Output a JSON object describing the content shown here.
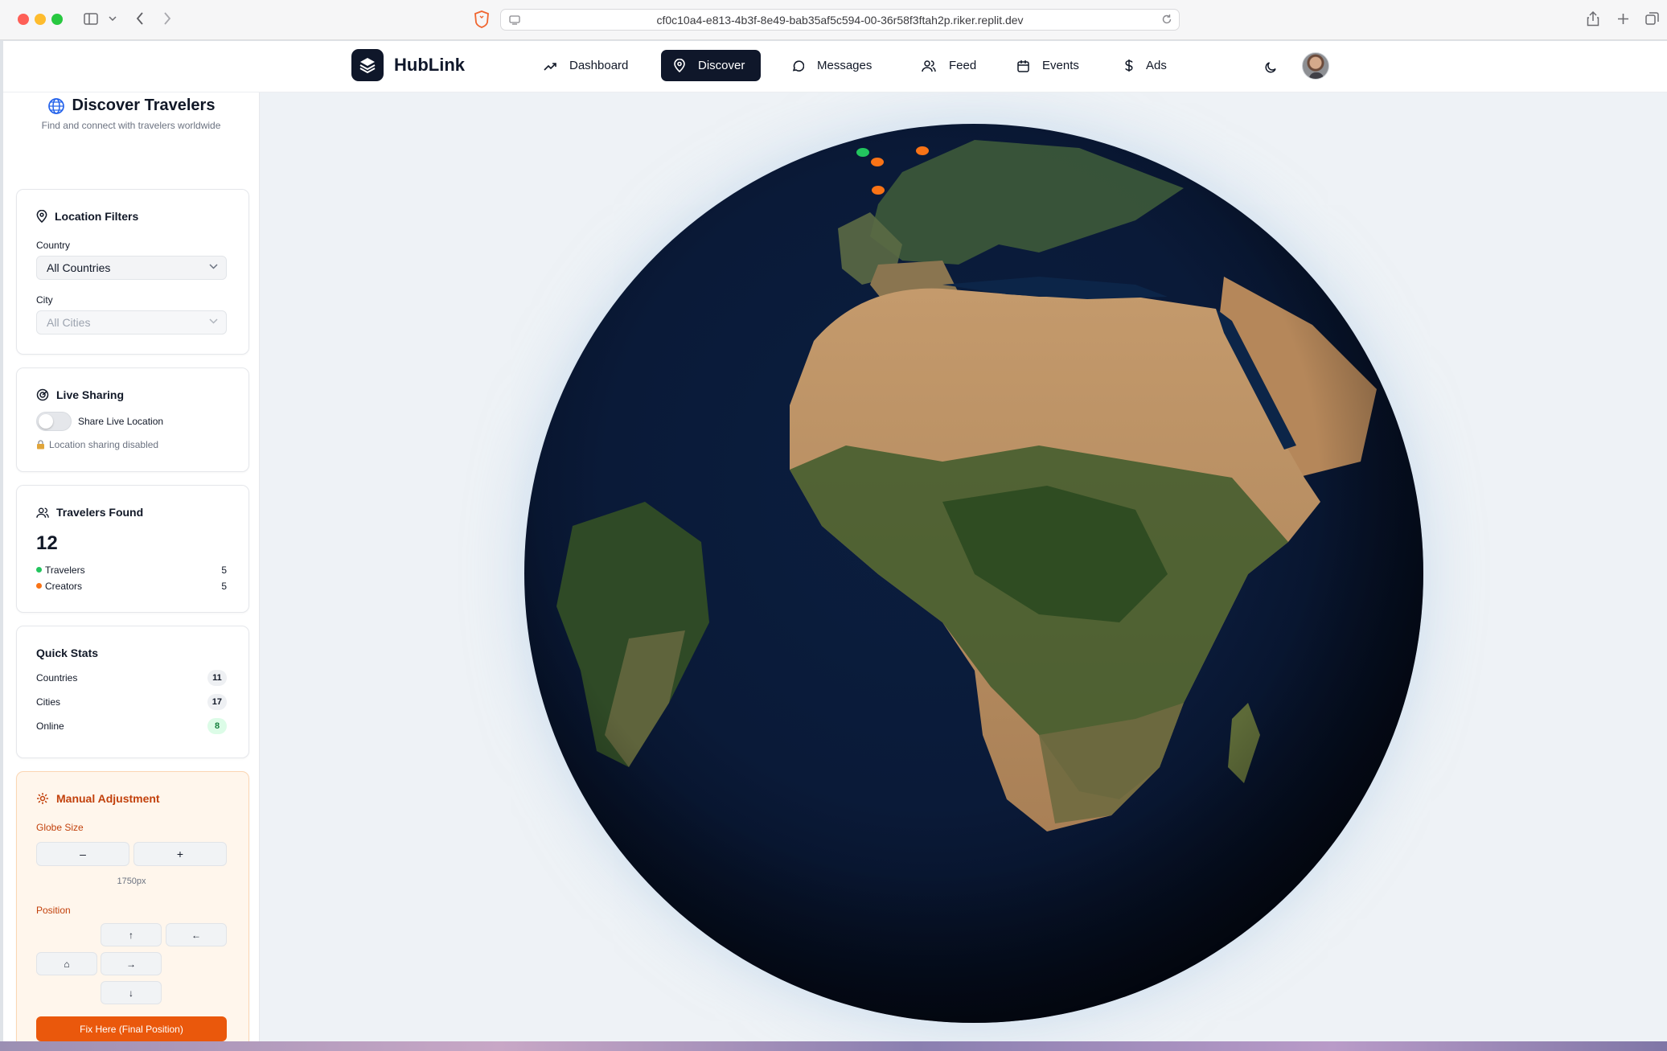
{
  "browser": {
    "url": "cf0c10a4-e813-4b3f-8e49-bab35af5c594-00-36r58f3ftah2p.riker.replit.dev"
  },
  "brand": {
    "name": "HubLink"
  },
  "nav": {
    "items": [
      {
        "label": "Dashboard",
        "icon": "trending-up-icon",
        "active": false
      },
      {
        "label": "Discover",
        "icon": "map-pin-icon",
        "active": true
      },
      {
        "label": "Messages",
        "icon": "message-circle-icon",
        "active": false
      },
      {
        "label": "Feed",
        "icon": "users-icon",
        "active": false
      },
      {
        "label": "Events",
        "icon": "calendar-icon",
        "active": false
      },
      {
        "label": "Ads",
        "icon": "dollar-icon",
        "active": false
      }
    ]
  },
  "sidebar": {
    "title": "Discover Travelers",
    "subtitle": "Find and connect with travelers worldwide",
    "filters": {
      "title": "Location Filters",
      "country_label": "Country",
      "country_value": "All Countries",
      "city_label": "City",
      "city_value": "All Cities"
    },
    "live": {
      "title": "Live Sharing",
      "toggle_label": "Share Live Location",
      "status": "Location sharing disabled",
      "enabled": false
    },
    "travelers": {
      "title": "Travelers Found",
      "count": "12",
      "rows": [
        {
          "label": "Travelers",
          "value": "5",
          "color": "#22c55e"
        },
        {
          "label": "Creators",
          "value": "5",
          "color": "#f97316"
        }
      ]
    },
    "quick_stats": {
      "title": "Quick Stats",
      "rows": [
        {
          "label": "Countries",
          "value": "11"
        },
        {
          "label": "Cities",
          "value": "17"
        },
        {
          "label": "Online",
          "value": "8"
        }
      ]
    },
    "manual": {
      "title": "Manual Adjustment",
      "size_label": "Globe Size",
      "minus": "–",
      "plus": "+",
      "size_value": "1750px",
      "position_label": "Position",
      "up": "↑",
      "left": "←",
      "home": "⌂",
      "right": "→",
      "down": "↓",
      "fix_label": "Fix Here (Final Position)"
    }
  },
  "colors": {
    "accent": "#0f172a",
    "traveler": "#22c55e",
    "creator": "#f97316",
    "manual_accent": "#ea580c"
  }
}
